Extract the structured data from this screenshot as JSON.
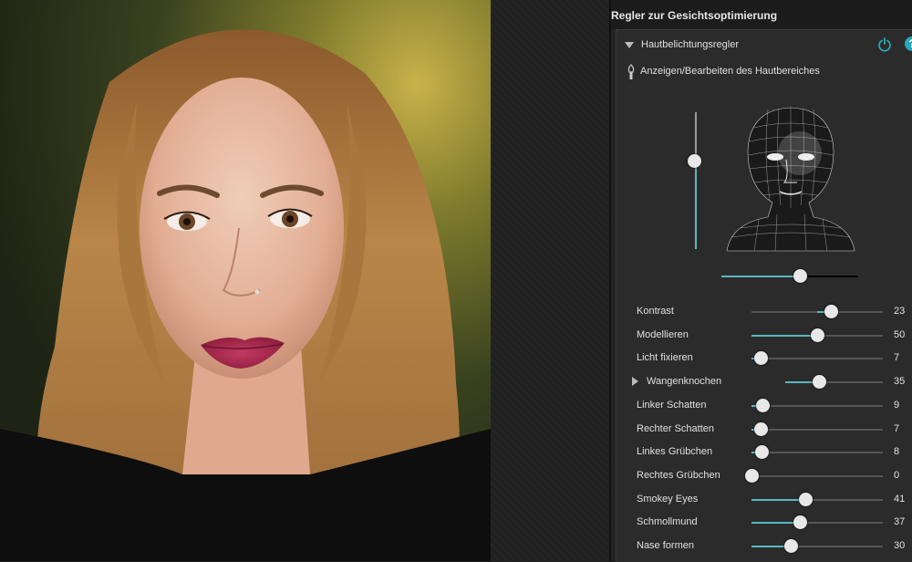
{
  "panel": {
    "title": "Regler zur Gesichtsoptimierung",
    "section_label": "Hautbelichtungsregler",
    "skin_area_label": "Anzeigen/Bearbeiten des Hautbereiches",
    "help_glyph": "?",
    "vertical_slider_level": 0.35,
    "horizontal_slider_level": 0.57
  },
  "sliders": [
    {
      "label": "Kontrast",
      "value": "23",
      "level": 0.61,
      "fill_from": 0.5,
      "expandable": false
    },
    {
      "label": "Modellieren",
      "value": "50",
      "level": 0.5,
      "fill_from": 0,
      "expandable": false
    },
    {
      "label": "Licht fixieren",
      "value": "7",
      "level": 0.07,
      "fill_from": 0,
      "expandable": false
    },
    {
      "label": "Wangenknochen",
      "value": "35",
      "level": 0.35,
      "fill_from": 0,
      "expandable": true
    },
    {
      "label": "Linker Schatten",
      "value": "9",
      "level": 0.09,
      "fill_from": 0,
      "expandable": false
    },
    {
      "label": "Rechter Schatten",
      "value": "7",
      "level": 0.07,
      "fill_from": 0,
      "expandable": false
    },
    {
      "label": "Linkes Grübchen",
      "value": "8",
      "level": 0.08,
      "fill_from": 0,
      "expandable": false
    },
    {
      "label": "Rechtes Grübchen",
      "value": "0",
      "level": 0.0,
      "fill_from": 0,
      "expandable": false
    },
    {
      "label": "Smokey Eyes",
      "value": "41",
      "level": 0.41,
      "fill_from": 0,
      "expandable": false
    },
    {
      "label": "Schmollmund",
      "value": "37",
      "level": 0.37,
      "fill_from": 0,
      "expandable": false
    },
    {
      "label": "Nase formen",
      "value": "30",
      "level": 0.3,
      "fill_from": 0,
      "expandable": false
    }
  ],
  "icons": {
    "power": "power-icon",
    "help": "help-icon",
    "skin": "skin-brush-icon",
    "collapse": "triangle-down-icon",
    "expand": "triangle-right-icon"
  },
  "colors": {
    "accent": "#5ab7bf",
    "panel_bg": "#2b2b2b",
    "lip": "#a0244a"
  }
}
